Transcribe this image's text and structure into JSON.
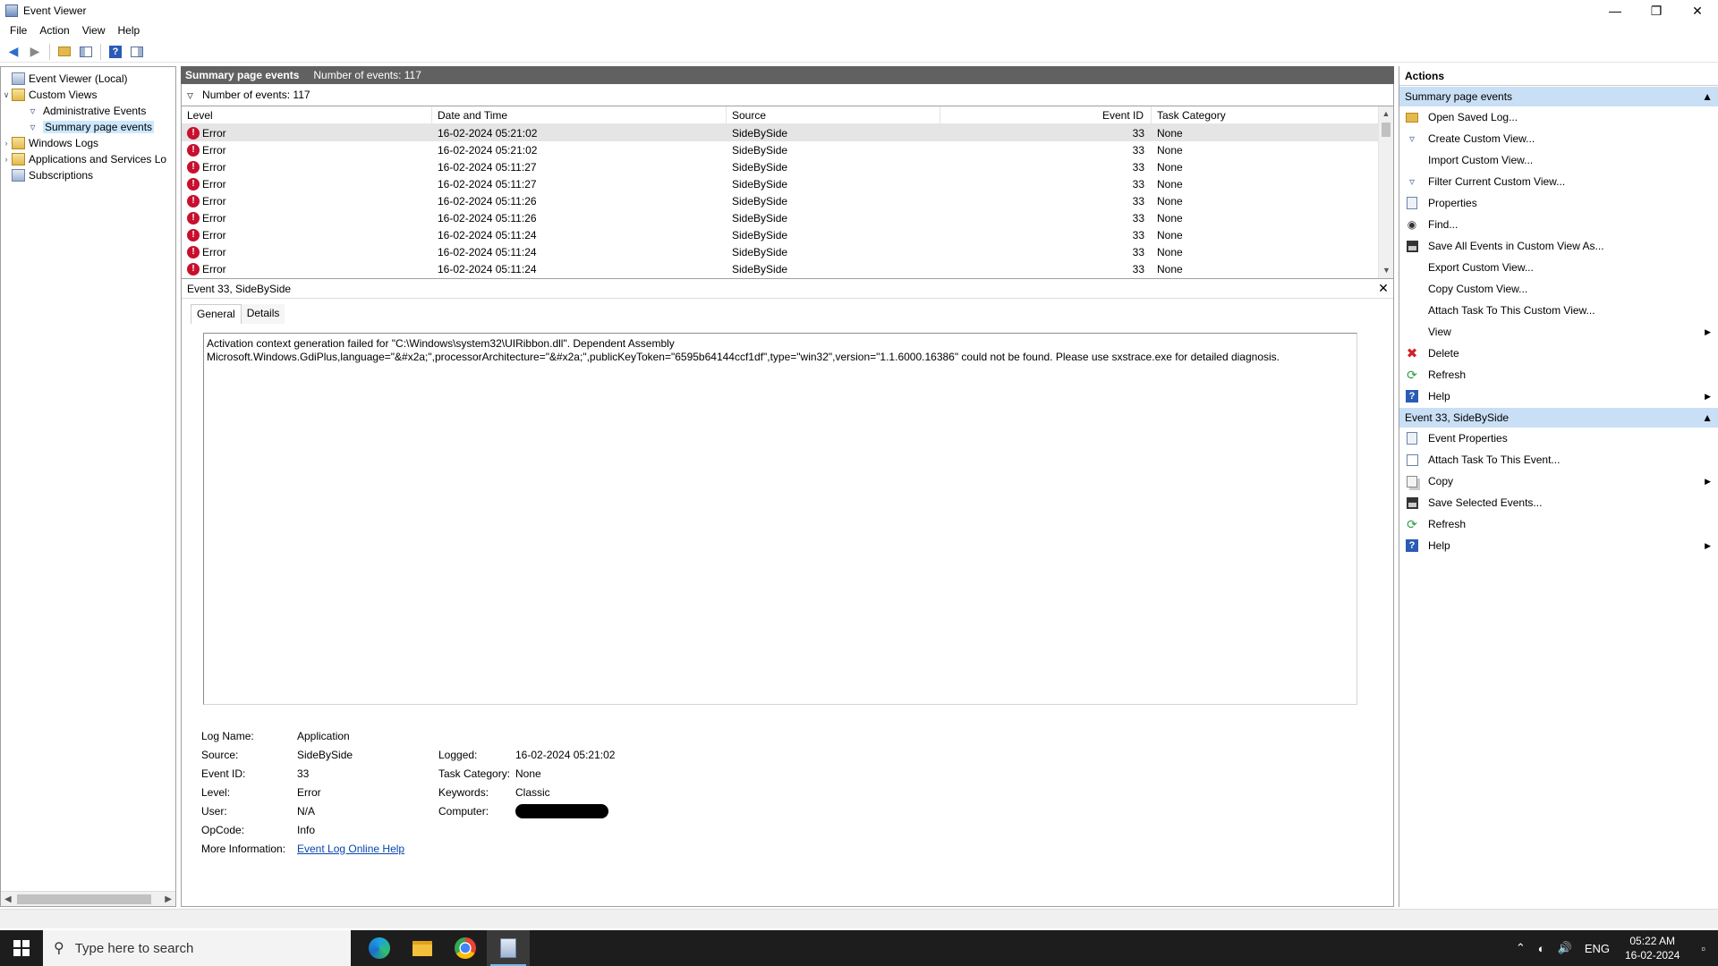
{
  "window": {
    "title": "Event Viewer",
    "minimize": "—",
    "restore": "❐",
    "close": "✕"
  },
  "menu": [
    "File",
    "Action",
    "View",
    "Help"
  ],
  "tree": {
    "root": "Event Viewer (Local)",
    "custom_views": "Custom Views",
    "admin_events": "Administrative Events",
    "summary_events": "Summary page events",
    "windows_logs": "Windows Logs",
    "apps_services": "Applications and Services Lo",
    "subscriptions": "Subscriptions"
  },
  "center": {
    "header_title": "Summary page events",
    "header_count": "Number of events: 117",
    "filter_count": "Number of events: 117",
    "columns": [
      "Level",
      "Date and Time",
      "Source",
      "Event ID",
      "Task Category"
    ],
    "rows": [
      {
        "level": "Error",
        "date": "16-02-2024 05:21:02",
        "source": "SideBySide",
        "id": "33",
        "cat": "None"
      },
      {
        "level": "Error",
        "date": "16-02-2024 05:21:02",
        "source": "SideBySide",
        "id": "33",
        "cat": "None"
      },
      {
        "level": "Error",
        "date": "16-02-2024 05:11:27",
        "source": "SideBySide",
        "id": "33",
        "cat": "None"
      },
      {
        "level": "Error",
        "date": "16-02-2024 05:11:27",
        "source": "SideBySide",
        "id": "33",
        "cat": "None"
      },
      {
        "level": "Error",
        "date": "16-02-2024 05:11:26",
        "source": "SideBySide",
        "id": "33",
        "cat": "None"
      },
      {
        "level": "Error",
        "date": "16-02-2024 05:11:26",
        "source": "SideBySide",
        "id": "33",
        "cat": "None"
      },
      {
        "level": "Error",
        "date": "16-02-2024 05:11:24",
        "source": "SideBySide",
        "id": "33",
        "cat": "None"
      },
      {
        "level": "Error",
        "date": "16-02-2024 05:11:24",
        "source": "SideBySide",
        "id": "33",
        "cat": "None"
      },
      {
        "level": "Error",
        "date": "16-02-2024 05:11:24",
        "source": "SideBySide",
        "id": "33",
        "cat": "None"
      }
    ]
  },
  "detail": {
    "title": "Event 33, SideBySide",
    "tab_general": "General",
    "tab_details": "Details",
    "message_line1": "Activation context generation failed for \"C:\\Windows\\system32\\UIRibbon.dll\". Dependent Assembly",
    "message_line2": "Microsoft.Windows.GdiPlus,language=\"&#x2a;\",processorArchitecture=\"&#x2a;\",publicKeyToken=\"6595b64144ccf1df\",type=\"win32\",version=\"1.1.6000.16386\" could not be found. Please use sxstrace.exe for detailed diagnosis.",
    "labels": {
      "log_name": "Log Name:",
      "source": "Source:",
      "event_id": "Event ID:",
      "level": "Level:",
      "user": "User:",
      "opcode": "OpCode:",
      "more_info": "More Information:",
      "logged": "Logged:",
      "task_category": "Task Category:",
      "keywords": "Keywords:",
      "computer": "Computer:"
    },
    "values": {
      "log_name": "Application",
      "source": "SideBySide",
      "event_id": "33",
      "level": "Error",
      "user": "N/A",
      "opcode": "Info",
      "more_info": "Event Log Online Help",
      "logged": "16-02-2024 05:21:02",
      "task_category": "None",
      "keywords": "Classic"
    }
  },
  "actions": {
    "title": "Actions",
    "section1": "Summary page events",
    "items1": [
      {
        "label": "Open Saved Log...",
        "icon": "folder-icon"
      },
      {
        "label": "Create Custom View...",
        "icon": "filter-icon"
      },
      {
        "label": "Import Custom View...",
        "icon": ""
      },
      {
        "label": "Filter Current Custom View...",
        "icon": "filter-icon"
      },
      {
        "label": "Properties",
        "icon": "properties-icon"
      },
      {
        "label": "Find...",
        "icon": "binoculars-icon"
      },
      {
        "label": "Save All Events in Custom View As...",
        "icon": "save-icon"
      },
      {
        "label": "Export Custom View...",
        "icon": ""
      },
      {
        "label": "Copy Custom View...",
        "icon": ""
      },
      {
        "label": "Attach Task To This Custom View...",
        "icon": ""
      },
      {
        "label": "View",
        "icon": "",
        "submenu": true
      },
      {
        "label": "Delete",
        "icon": "delete-icon"
      },
      {
        "label": "Refresh",
        "icon": "refresh-icon"
      },
      {
        "label": "Help",
        "icon": "help-icon",
        "submenu": true
      }
    ],
    "section2": "Event 33, SideBySide",
    "items2": [
      {
        "label": "Event Properties",
        "icon": "properties-icon"
      },
      {
        "label": "Attach Task To This Event...",
        "icon": "task-icon"
      },
      {
        "label": "Copy",
        "icon": "copy-icon",
        "submenu": true
      },
      {
        "label": "Save Selected Events...",
        "icon": "save-icon"
      },
      {
        "label": "Refresh",
        "icon": "refresh-icon"
      },
      {
        "label": "Help",
        "icon": "help-icon",
        "submenu": true
      }
    ]
  },
  "taskbar": {
    "search_placeholder": "Type here to search",
    "lang": "ENG",
    "time": "05:22 AM",
    "date": "16-02-2024"
  },
  "colors": {
    "section_bg": "#c9dff5",
    "header_bg": "#616161",
    "error_red": "#c8102e",
    "taskbar": "#1d1d1d"
  }
}
